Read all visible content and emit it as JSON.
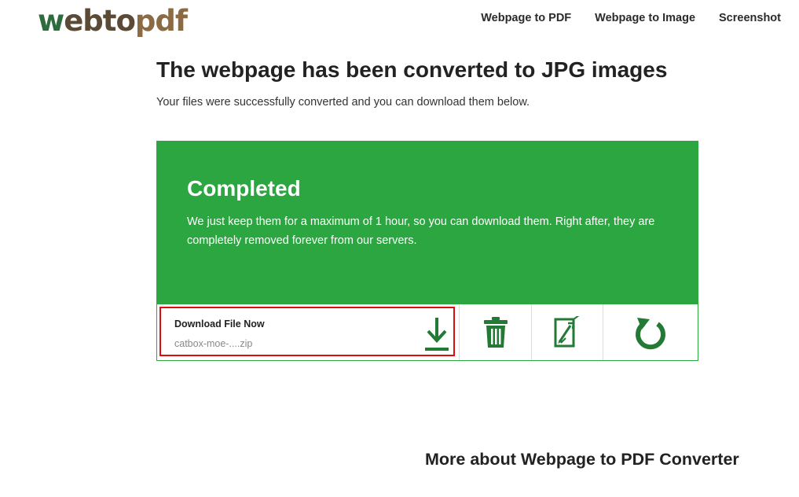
{
  "header": {
    "logo": {
      "w": "w",
      "rest": "ebto",
      "pdf": "pdf"
    },
    "nav": [
      {
        "label": "Webpage to PDF"
      },
      {
        "label": "Webpage to Image"
      },
      {
        "label": "Screenshot"
      }
    ]
  },
  "main": {
    "title": "The webpage has been converted to JPG images",
    "subtitle": "Your files were successfully converted and you can download them below."
  },
  "card": {
    "heading": "Completed",
    "text": "We just keep them for a maximum of 1 hour, so you can download them. Right after, they are completely removed forever from our servers.",
    "download": {
      "label": "Download File Now",
      "filename": "catbox-moe-....zip",
      "icon": "download-icon"
    },
    "actions": [
      {
        "icon": "trash-icon"
      },
      {
        "icon": "edit-file-icon"
      },
      {
        "icon": "restart-icon"
      }
    ]
  },
  "footer": {
    "more_heading": "More about Webpage to PDF Converter"
  },
  "colors": {
    "accent": "#2ba640",
    "highlight": "#e00d0d",
    "icon": "#237a34"
  }
}
